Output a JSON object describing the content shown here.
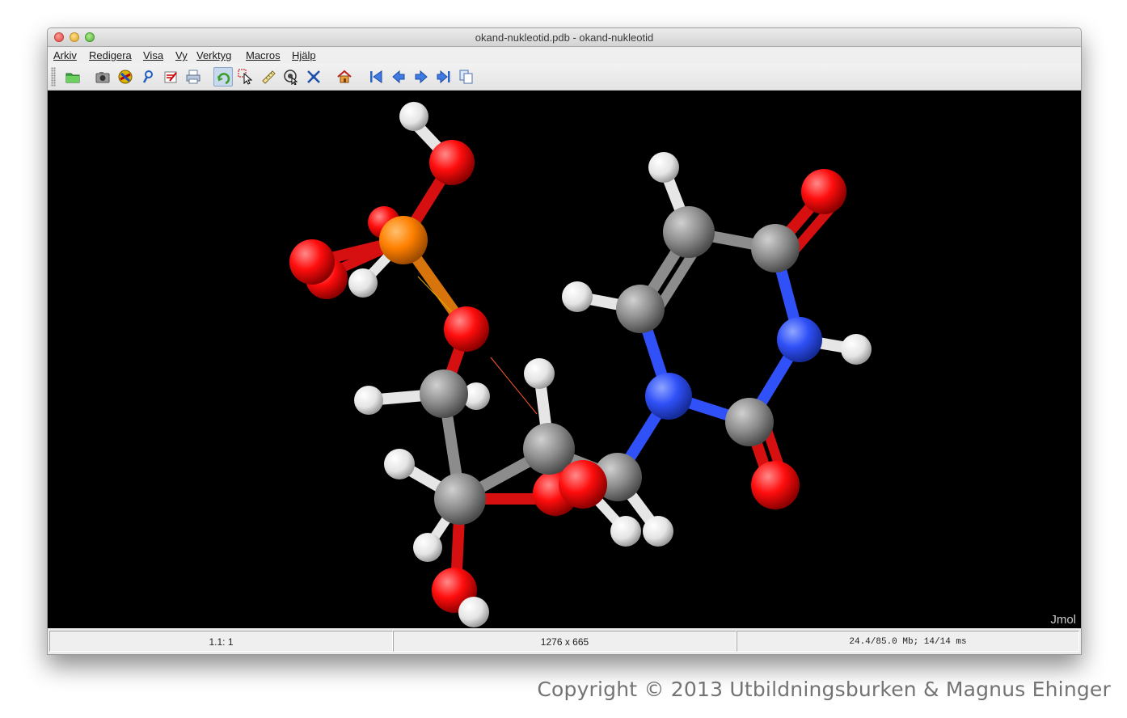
{
  "window": {
    "title": "okand-nukleotid.pdb - okand-nukleotid"
  },
  "menu": {
    "items": [
      "Arkiv",
      "Redigera",
      "Visa",
      "Vy",
      "Verktyg",
      "Macros",
      "Hjälp"
    ]
  },
  "toolbar": {
    "buttons": [
      {
        "icon": "open-folder-icon"
      },
      {
        "icon": "camera-icon"
      },
      {
        "icon": "render-icon"
      },
      {
        "icon": "script-icon"
      },
      {
        "icon": "edit-icon"
      },
      {
        "icon": "print-icon"
      },
      {
        "icon": "rotate-icon",
        "active": true
      },
      {
        "icon": "select-pointer-icon"
      },
      {
        "icon": "ruler-icon"
      },
      {
        "icon": "pick-center-icon"
      },
      {
        "icon": "move-arrows-icon"
      },
      {
        "icon": "home-icon"
      },
      {
        "icon": "first-frame-icon"
      },
      {
        "icon": "previous-frame-icon"
      },
      {
        "icon": "next-frame-icon"
      },
      {
        "icon": "last-frame-icon"
      },
      {
        "icon": "copy-frames-icon"
      }
    ]
  },
  "viewer": {
    "background": "#000000",
    "watermark": "Jmol",
    "molecule": "okand-nukleotid",
    "atom_colors": {
      "carbon": "#8c8c8c",
      "hydrogen": "#f2f2f2",
      "oxygen": "#ff0d0d",
      "nitrogen": "#3050f8",
      "phosphorus": "#ff8000"
    }
  },
  "status": {
    "frame": "1.1: 1",
    "dimensions": "1276 x 665",
    "memory": "24.4/85.0 Mb;  14/14 ms"
  },
  "footer": {
    "copyright": "Copyright © 2013 Utbildningsburken & Magnus Ehinger"
  }
}
